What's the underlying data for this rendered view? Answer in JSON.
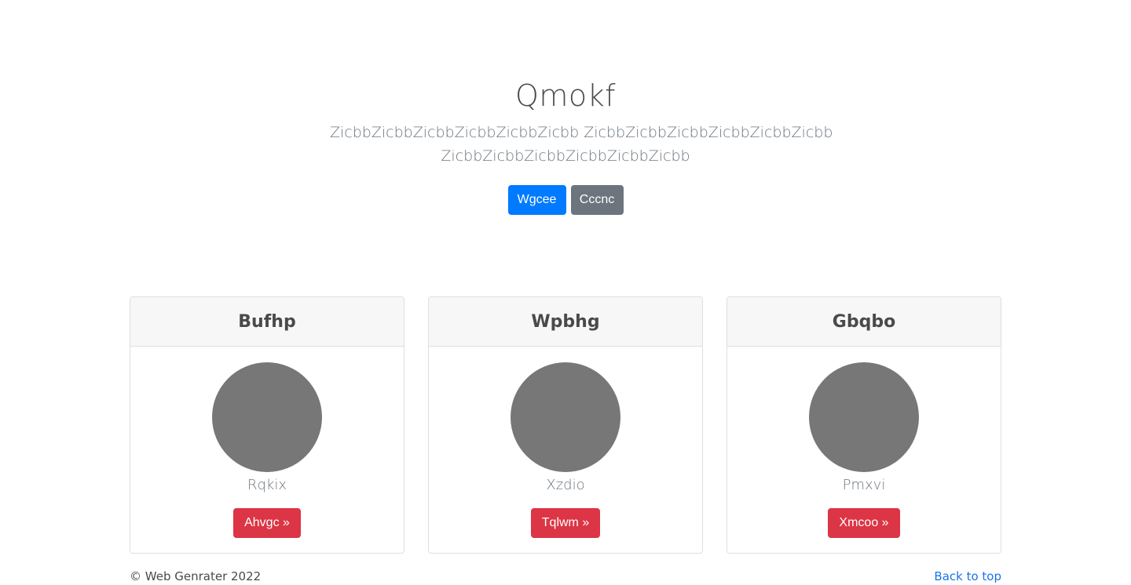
{
  "hero": {
    "title": "Qmokf",
    "lead_line1": "ZicbbZicbbZicbbZicbbZicbbZicbb ZicbbZicbbZicbbZicbbZicbbZicbb",
    "lead_line2": "ZicbbZicbbZicbbZicbbZicbbZicbb",
    "primary_button": "Wgcee",
    "secondary_button": "Cccnc"
  },
  "cards": [
    {
      "title": "Bufhp",
      "name": "Rqkix",
      "button": "Ahvgc »"
    },
    {
      "title": "Wpbhg",
      "name": "Xzdio",
      "button": "Tqlwm »"
    },
    {
      "title": "Gbqbo",
      "name": "Pmxvi",
      "button": "Xmcoo »"
    }
  ],
  "footer": {
    "copyright": "© Web Genrater 2022",
    "back_to_top": "Back to top"
  },
  "colors": {
    "primary": "#007bff",
    "secondary": "#6c757d",
    "danger": "#dc3545",
    "avatar": "#777777"
  }
}
